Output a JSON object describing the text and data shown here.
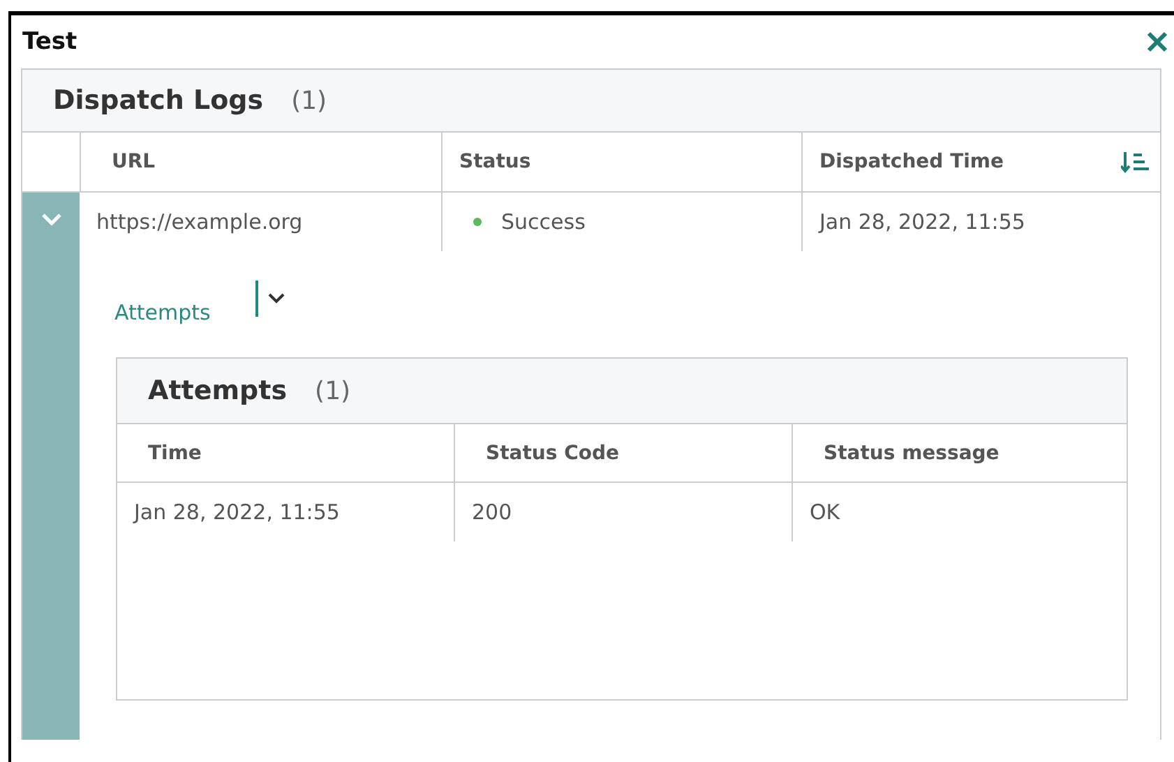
{
  "window": {
    "title": "Test"
  },
  "dispatch_logs": {
    "title": "Dispatch Logs",
    "count": "(1)",
    "columns": [
      {
        "label": "URL",
        "sortable": false
      },
      {
        "label": "Status",
        "sortable": false
      },
      {
        "label": "Dispatched Time",
        "sortable": true
      }
    ],
    "rows": [
      {
        "url": "https://example.org",
        "status": "Success",
        "color": "#5cb85c",
        "dispatched_time": "Jan 28, 2022, 11:55",
        "expanded": true,
        "details": {
          "attempts_toggle": {
            "label": "Attempts",
            "expanded": true
          },
          "attempts": {
            "title": "Attempts",
            "count": "(1)",
            "columns": [
              "Time",
              "Status Code",
              "Status message"
            ],
            "rows": [
              [
                "Jan 28, 2022, 11:55",
                "200",
                "OK"
              ]
            ]
          }
        }
      }
    ]
  }
}
